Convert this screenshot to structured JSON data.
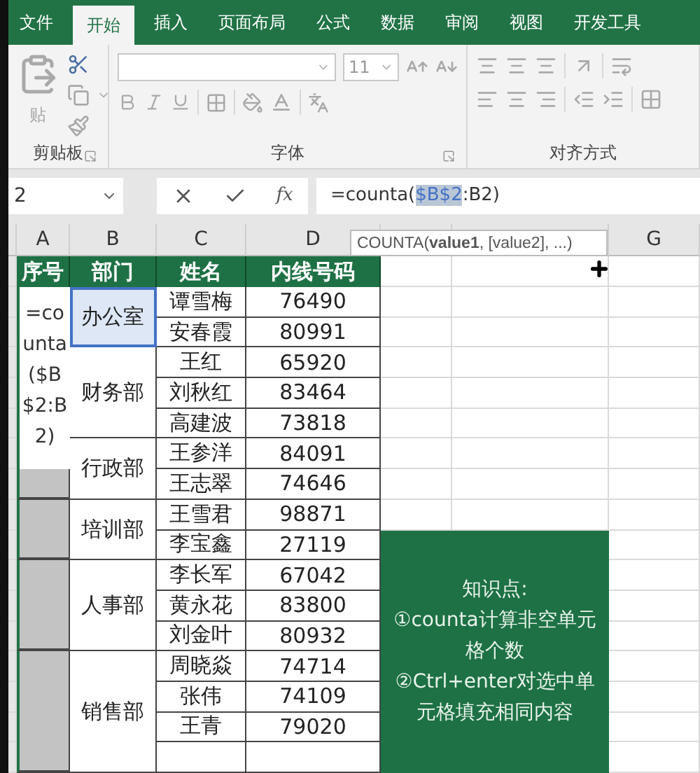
{
  "ribbon": {
    "tabs": [
      {
        "label": "文件",
        "selected": false
      },
      {
        "label": "开始",
        "selected": true
      },
      {
        "label": "插入",
        "selected": false
      },
      {
        "label": "页面布局",
        "selected": false
      },
      {
        "label": "公式",
        "selected": false
      },
      {
        "label": "数据",
        "selected": false
      },
      {
        "label": "审阅",
        "selected": false
      },
      {
        "label": "视图",
        "selected": false
      },
      {
        "label": "开发工具",
        "selected": false
      }
    ],
    "paste_label": "贴",
    "font_size": "11",
    "groups": [
      "剪贴板",
      "字体",
      "对齐方式"
    ]
  },
  "formula_bar": {
    "name_box": "2",
    "fx": "fx",
    "formula_before": "=counta(",
    "formula_selected": "$B$2",
    "formula_after": ":B2)"
  },
  "tooltip": "COUNTA(**value1**, [value2], ...)",
  "column_headers": [
    "A",
    "B",
    "C",
    "D",
    "G"
  ],
  "table": {
    "headers": [
      "序号",
      "部门",
      "姓名",
      "内线号码"
    ],
    "departments": [
      {
        "name": "办公室",
        "referenced": true,
        "people": [
          {
            "name": "谭雪梅",
            "ext": "76490"
          },
          {
            "name": "安春霞",
            "ext": "80991"
          }
        ]
      },
      {
        "name": "财务部",
        "referenced": false,
        "people": [
          {
            "name": "王红",
            "ext": "65920"
          },
          {
            "name": "刘秋红",
            "ext": "83464"
          },
          {
            "name": "高建波",
            "ext": "73818"
          }
        ]
      },
      {
        "name": "行政部",
        "selected": true,
        "referenced": false,
        "people": [
          {
            "name": "王参洋",
            "ext": "84091"
          },
          {
            "name": "王志翠",
            "ext": "74646"
          }
        ]
      },
      {
        "name": "培训部",
        "selected": true,
        "referenced": false,
        "people": [
          {
            "name": "王雪君",
            "ext": "98871"
          },
          {
            "name": "李宝鑫",
            "ext": "27119"
          }
        ]
      },
      {
        "name": "人事部",
        "selected": true,
        "referenced": false,
        "people": [
          {
            "name": "李长军",
            "ext": "67042"
          },
          {
            "name": "黄永花",
            "ext": "83800"
          },
          {
            "name": "刘金叶",
            "ext": "80932"
          }
        ]
      },
      {
        "name": "销售部",
        "selected": true,
        "referenced": false,
        "people": [
          {
            "name": "周晓焱",
            "ext": "74714"
          },
          {
            "name": "张伟",
            "ext": "74109"
          },
          {
            "name": "王青",
            "ext": "79020"
          }
        ]
      }
    ]
  },
  "editor": {
    "text": "=counta($B$2:B2)"
  },
  "note": {
    "lines": [
      "知识点:",
      "①counta计算非空单元格个数",
      "②Ctrl+enter对选中单元格填充相同内容"
    ]
  }
}
